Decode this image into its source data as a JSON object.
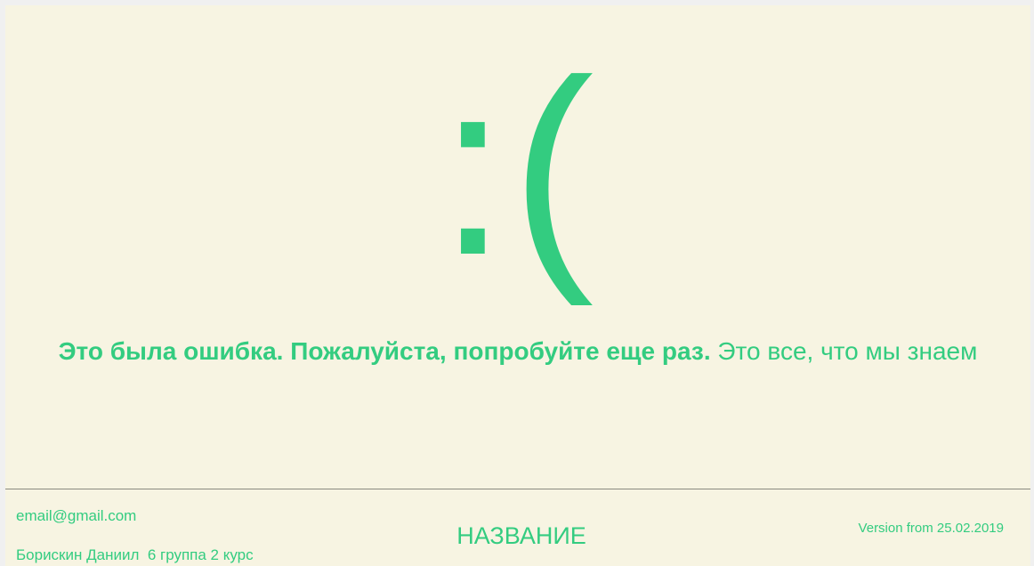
{
  "error": {
    "face": ":(",
    "message_bold": "Это была ошибка. Пожалуйста, попробуйте еще раз.",
    "message_regular": " Это все, что мы знаем"
  },
  "footer": {
    "email": "email@gmail.com",
    "author": "Борискин Даниил  6 группа 2 курс",
    "brand": "НАЗВАНИЕ",
    "version": "Version from 25.02.2019"
  },
  "colors": {
    "accent": "#33cc80",
    "background": "#f7f4e2"
  }
}
